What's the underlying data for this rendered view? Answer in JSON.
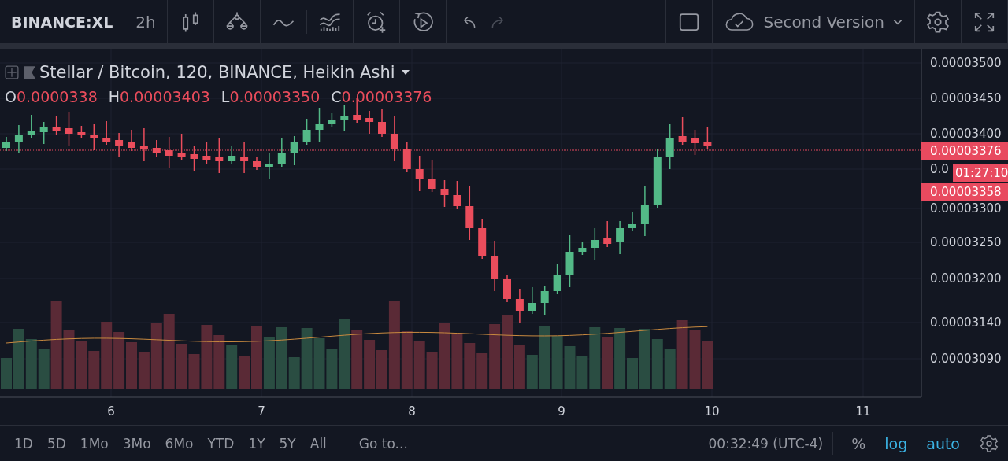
{
  "toolbar": {
    "symbol": "BINANCE:XL",
    "interval": "2h",
    "layout_name": "Second Version"
  },
  "legend": {
    "title": "Stellar / Bitcoin, 120, BINANCE, Heikin Ashi",
    "values": [
      {
        "key": "O",
        "value": "0.0000338"
      },
      {
        "key": "H",
        "value": "0.00003403"
      },
      {
        "key": "L",
        "value": "0.00003350"
      },
      {
        "key": "C",
        "value": "0.00003376"
      }
    ]
  },
  "price_axis": {
    "ticks": [
      "0.00003500",
      "0.00003450",
      "0.00003400",
      "0.0",
      "0.00003300",
      "0.00003250",
      "0.00003200",
      "0.00003140",
      "0.00003090"
    ],
    "last_price": "0.00003376",
    "countdown": "01:27:10",
    "second_price": "0.00003358"
  },
  "time_axis": {
    "ticks": [
      "6",
      "7",
      "8",
      "9",
      "10",
      "11"
    ]
  },
  "bottom_bar": {
    "ranges": [
      "1D",
      "5D",
      "1Mo",
      "3Mo",
      "6Mo",
      "YTD",
      "1Y",
      "5Y",
      "All"
    ],
    "goto": "Go to...",
    "time": "00:32:49 (UTC-4)",
    "toggles": [
      {
        "label": "%",
        "on": false
      },
      {
        "label": "log",
        "on": true
      },
      {
        "label": "auto",
        "on": true
      }
    ]
  }
}
